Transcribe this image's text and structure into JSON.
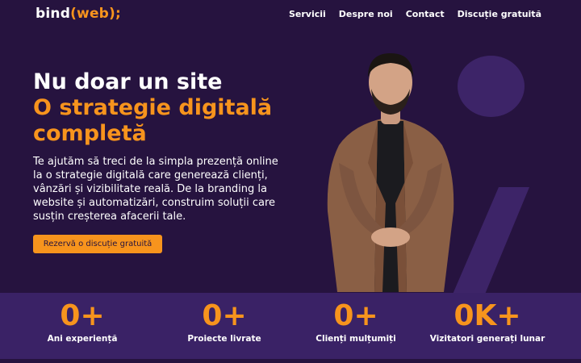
{
  "header": {
    "logo_main": "bind",
    "logo_accent": "(web);",
    "nav": [
      "Servicii",
      "Despre noi",
      "Contact",
      "Discuție gratuită"
    ]
  },
  "hero": {
    "title_line1": "Nu doar un site",
    "title_line2": "O strategie digitală completă",
    "description": "Te ajutăm să treci de la simpla prezență online la o strategie digitală care generează clienți, vânzări și vizibilitate reală. De la branding la website și automatizări, construim soluții care susțin creșterea afacerii tale.",
    "cta_label": "Rezervă o discuție gratuită"
  },
  "stats": [
    {
      "value": "0+",
      "label": "Ani experiență"
    },
    {
      "value": "0+",
      "label": "Proiecte livrate"
    },
    {
      "value": "0+",
      "label": "Clienți mulțumiți"
    },
    {
      "value": "0K+",
      "label": "Vizitatori generați lunar"
    }
  ],
  "colors": {
    "background": "#26133f",
    "accent": "#f7941d",
    "stats_band": "#3a2266",
    "decoration": "#3d2468"
  }
}
